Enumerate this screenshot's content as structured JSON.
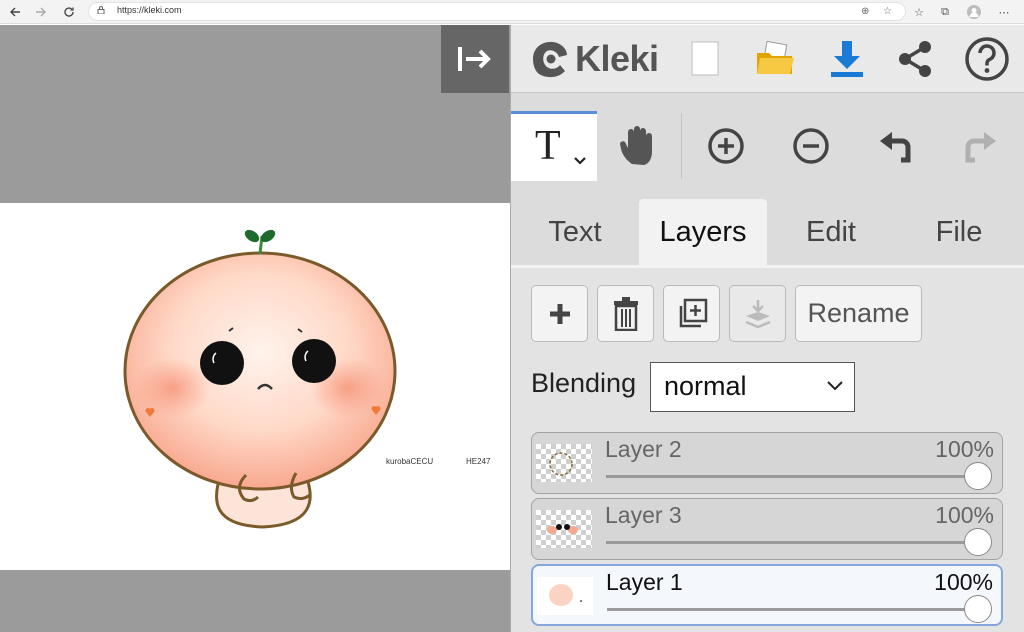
{
  "browser": {
    "url": "https://kleki.com"
  },
  "app": {
    "logo_text": "Kleki"
  },
  "tools": {
    "active_tool_glyph": "T"
  },
  "tabs": [
    {
      "label": "Text"
    },
    {
      "label": "Layers"
    },
    {
      "label": "Edit"
    },
    {
      "label": "File"
    }
  ],
  "active_tab": "Layers",
  "layer_buttons": {
    "rename_label": "Rename"
  },
  "blending": {
    "label": "Blending",
    "value": "normal"
  },
  "layers": [
    {
      "name": "Layer 2",
      "opacity": "100%",
      "opacity_value": 1.0,
      "active": false
    },
    {
      "name": "Layer 3",
      "opacity": "100%",
      "opacity_value": 1.0,
      "active": false
    },
    {
      "name": "Layer 1",
      "opacity": "100%",
      "opacity_value": 1.0,
      "active": true
    }
  ],
  "canvas": {
    "signature_left": "kurobaCECU",
    "signature_right": "HE247"
  },
  "icons": {
    "back": "back-arrow-icon",
    "forward": "forward-arrow-icon",
    "reload": "reload-icon",
    "collapse": "collapse-panel-icon",
    "new": "new-document-icon",
    "open": "open-folder-icon",
    "save": "download-icon",
    "share": "share-icon",
    "help": "help-icon",
    "hand": "hand-tool-icon",
    "zoom_in": "zoom-in-icon",
    "zoom_out": "zoom-out-icon",
    "undo": "undo-icon",
    "redo": "redo-icon"
  },
  "colors": {
    "accent_blue": "#1a7ad6",
    "folder_yellow": "#f4c430",
    "active_tab_bar": "#5a8fd8",
    "canvas_bg": "#9b9b9b"
  }
}
